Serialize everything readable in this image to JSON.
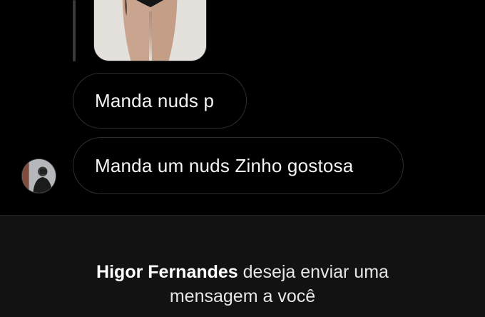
{
  "thread": {
    "messages": [
      {
        "text": "Manda nuds p"
      },
      {
        "text": "Manda um nuds Zinho gostosa"
      }
    ]
  },
  "request": {
    "sender_name": "Higor Fernandes",
    "line_1_rest": " deseja enviar uma",
    "line_2": "mensagem a você"
  },
  "colors": {
    "background": "#000000",
    "panel": "#121212",
    "bubble_border": "#2f2f2f",
    "text": "#f5f5f5"
  }
}
